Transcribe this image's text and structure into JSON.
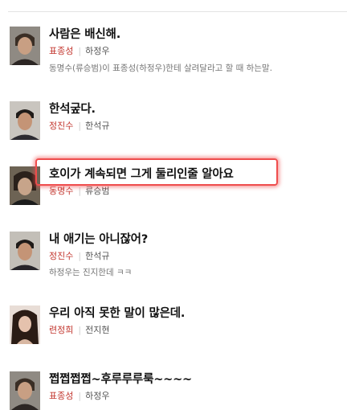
{
  "items": [
    {
      "quote": "사람은 배신해.",
      "role": "표종성",
      "actor": "하정우",
      "desc": "동명수(류승범)이 표종성(하정우)한테 살려달라고 할 때 하는말."
    },
    {
      "quote": "한석궆다.",
      "role": "정진수",
      "actor": "한석규",
      "desc": ""
    },
    {
      "quote": "호이가 계속되면 그게 둘리인줄 알아요",
      "role": "동명수",
      "actor": "류승범",
      "desc": ""
    },
    {
      "quote": "내 애기는 아니잖어?",
      "role": "정진수",
      "actor": "한석규",
      "desc": "하정우는 진지한데 ㅋㅋ"
    },
    {
      "quote": "우리 아직 못한 말이 많은데.",
      "role": "련정희",
      "actor": "전지현",
      "desc": ""
    },
    {
      "quote": "쩝쩝쩝쩝~후루루루룩~~~~",
      "role": "표종성",
      "actor": "하정우",
      "desc": ""
    }
  ],
  "highlighted_item": 2,
  "colors": {
    "role_text": "#c2352d",
    "highlight_border": "#ef4d4d"
  }
}
